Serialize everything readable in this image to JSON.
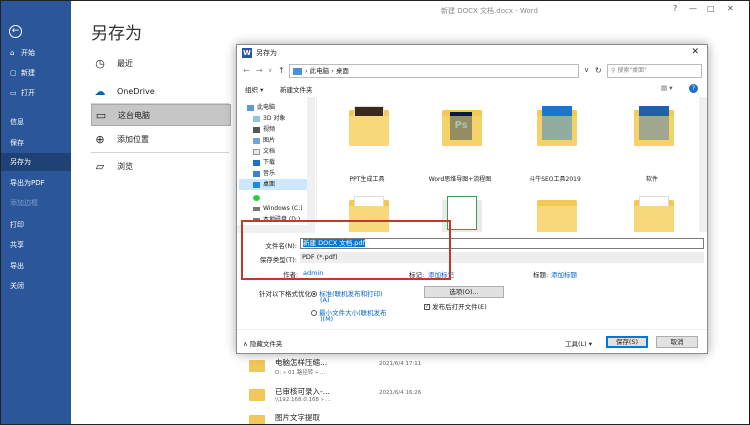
{
  "window": {
    "title": "新建 DOCX 文档.docx  -  Word",
    "controls": [
      "?",
      "—",
      "□",
      "✕"
    ]
  },
  "backstage": {
    "title": "另存为",
    "nav": [
      {
        "label": "开始",
        "icon": "⌂"
      },
      {
        "label": "新建",
        "icon": "▢"
      },
      {
        "label": "打开",
        "icon": "▭"
      },
      {
        "label": "信息",
        "icon": ""
      },
      {
        "label": "保存",
        "icon": ""
      },
      {
        "label": "另存为",
        "icon": ""
      },
      {
        "label": "导出为PDF",
        "icon": ""
      },
      {
        "label": "添加边框",
        "icon": ""
      },
      {
        "label": "打印",
        "icon": ""
      },
      {
        "label": "共享",
        "icon": ""
      },
      {
        "label": "导出",
        "icon": ""
      },
      {
        "label": "关闭",
        "icon": ""
      }
    ],
    "locations": [
      {
        "label": "最近"
      },
      {
        "label": "OneDrive"
      },
      {
        "label": "这台电脑"
      },
      {
        "label": "添加位置"
      },
      {
        "label": "浏览"
      }
    ],
    "recent": [
      {
        "name": "电脑怎样压缩...",
        "path": "D: » 01 路径转 » ...",
        "date": "2021/6/4 17:11"
      },
      {
        "name": "已审核可录入-...",
        "path": "\\\\192.168.0.168 » ...",
        "date": "2021/6/4 16:26"
      },
      {
        "name": "图片文字提取",
        "path": "",
        "date": ""
      }
    ]
  },
  "dialog": {
    "title": "另存为",
    "address": [
      "此电脑",
      "桌面"
    ],
    "search_placeholder": "搜索\"桌面\"",
    "toolbar": {
      "organize": "组织 ▾",
      "new_folder": "新建文件夹"
    },
    "tree": [
      {
        "label": "此电脑",
        "icon": "pc"
      },
      {
        "label": "3D 对象",
        "icon": "3d"
      },
      {
        "label": "视频",
        "icon": "video"
      },
      {
        "label": "图片",
        "icon": "picture"
      },
      {
        "label": "文档",
        "icon": "doc"
      },
      {
        "label": "下载",
        "icon": "download"
      },
      {
        "label": "音乐",
        "icon": "music"
      },
      {
        "label": "桌面",
        "icon": "desktop"
      },
      {
        "label": "",
        "icon": "green"
      },
      {
        "label": "Windows (C:)",
        "icon": "drive"
      },
      {
        "label": "本地磁盘 (D:)",
        "icon": "drive"
      }
    ],
    "files": [
      {
        "label": "PPT生成工具"
      },
      {
        "label": "Word思维导图+流程图"
      },
      {
        "label": "斗牛SEO工具2019"
      },
      {
        "label": "软件"
      },
      {
        "label": ""
      },
      {
        "label": ""
      },
      {
        "label": ""
      },
      {
        "label": ""
      }
    ],
    "filename_label": "文件名(N):",
    "filename_value": "新建 DOCX 文档.pdf",
    "filetype_label": "保存类型(T):",
    "filetype_value": "PDF (*.pdf)",
    "author_label": "作者:",
    "author_value": "admin",
    "tags_label": "标记:",
    "tags_value": "添加标记",
    "title_label": "标题:",
    "title_value": "添加标题",
    "optimize_label": "针对以下格式优化:",
    "opt1_a": "标准(联机发布和打印)",
    "opt1_b": "(A)",
    "opt2_a": "最小文件大小(联机发布",
    "opt2_b": ")(M)",
    "options_button": "选项(O)...",
    "open_after": "发布后打开文件(E)",
    "hide_folders": "隐藏文件夹",
    "tools": "工具(L) ▾",
    "save": "保存(S)",
    "cancel": "取消"
  }
}
